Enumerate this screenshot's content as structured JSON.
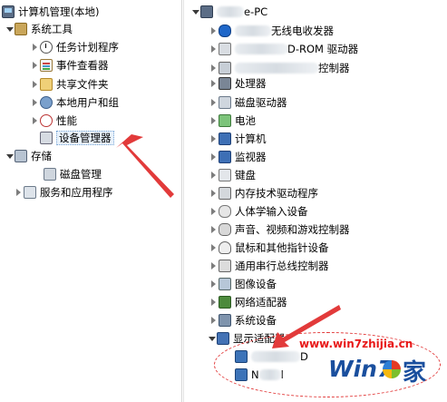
{
  "left_tree": {
    "root": "计算机管理(本地)",
    "system_tools": "系统工具",
    "task_scheduler": "任务计划程序",
    "event_viewer": "事件查看器",
    "shared_folders": "共享文件夹",
    "local_users": "本地用户和组",
    "performance": "性能",
    "device_manager": "设备管理器",
    "storage": "存储",
    "disk_management": "磁盘管理",
    "services_apps": "服务和应用程序"
  },
  "right_tree": {
    "computer_suffix": "e-PC",
    "bluetooth_suffix": "无线电收发器",
    "cdrom_suffix": "D-ROM 驱动器",
    "controller_suffix": "控制器",
    "processor": "处理器",
    "disk_drives": "磁盘驱动器",
    "battery": "电池",
    "computer": "计算机",
    "monitors": "监视器",
    "keyboard": "键盘",
    "memory_tech": "内存技术驱动程序",
    "hid": "人体学输入设备",
    "sound": "声音、视频和游戏控制器",
    "mouse": "鼠标和其他指针设备",
    "usb": "通用串行总线控制器",
    "imaging": "图像设备",
    "network": "网络适配器",
    "system_devices": "系统设备",
    "display_adapters": "显示适配器",
    "adapter1_suffix": "D",
    "adapter2_prefix": "N",
    "adapter2_suffix": "l"
  },
  "watermark": {
    "url": "www.win7zhijia.cn",
    "logo_text": "Win7",
    "logo_char": "家"
  },
  "colors": {
    "arrow": "#e23a3a",
    "selection": "#e8f1fb",
    "logo_blue": "#1a4f9e"
  }
}
